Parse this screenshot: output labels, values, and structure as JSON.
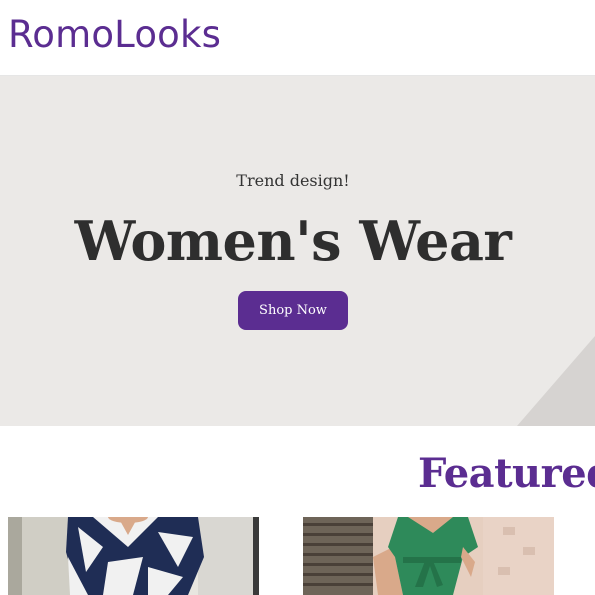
{
  "header": {
    "logo_text": "RomoLooks"
  },
  "hero": {
    "subtitle": "Trend design!",
    "title": "Women's Wear",
    "cta_label": "Shop Now"
  },
  "featured": {
    "title": "Featured Products"
  },
  "products": [
    {
      "image_icon": "patterned-dress-photo"
    },
    {
      "image_icon": "green-dress-photo"
    }
  ],
  "colors": {
    "brand": "#5b2d91",
    "hero_bg": "#ebe9e7",
    "hero_text": "#2e2e2e"
  }
}
